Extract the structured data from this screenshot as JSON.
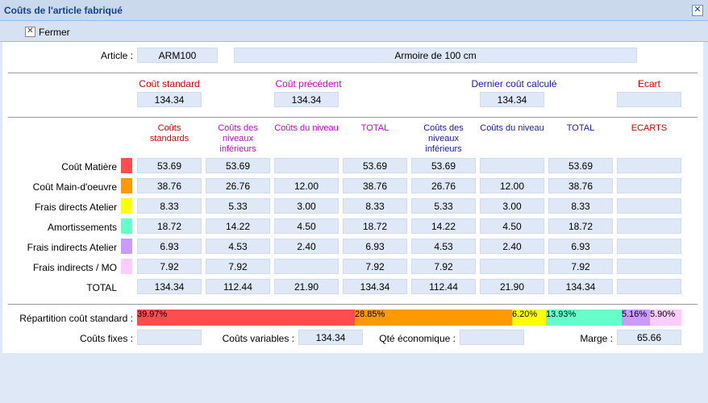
{
  "window": {
    "title": "Coûts de l'article fabriqué"
  },
  "toolbar": {
    "close_label": "Fermer"
  },
  "article": {
    "label": "Article :",
    "code": "ARM100",
    "description": "Armoire de 100 cm"
  },
  "summary": {
    "labels": [
      "Coût standard",
      "Coût précédent",
      "Dernier coût calculé",
      "Ecart"
    ],
    "values": [
      "134.34",
      "134.34",
      "134.34",
      ""
    ]
  },
  "headers": [
    "Coûts standards",
    "Coûts des niveaux inférieurs",
    "Coûts du niveau",
    "TOTAL",
    "Coûts des niveaux inférieurs",
    "Coûts du niveau",
    "TOTAL",
    "ECARTS"
  ],
  "colors": {
    "matiere": "#ff4d4d",
    "mo": "#ff9900",
    "frais_directs": "#ffff00",
    "amort": "#66ffcc",
    "frais_indirects": "#cc99ff",
    "frais_mo": "#ffccff"
  },
  "rows": [
    {
      "label": "Coût Matière",
      "color": "#ff4d4d",
      "values": [
        "53.69",
        "53.69",
        "",
        "53.69",
        "53.69",
        "",
        "53.69",
        ""
      ]
    },
    {
      "label": "Coût Main-d'oeuvre",
      "color": "#ff9900",
      "values": [
        "38.76",
        "26.76",
        "12.00",
        "38.76",
        "26.76",
        "12.00",
        "38.76",
        ""
      ]
    },
    {
      "label": "Frais directs Atelier",
      "color": "#ffff00",
      "values": [
        "8.33",
        "5.33",
        "3.00",
        "8.33",
        "5.33",
        "3.00",
        "8.33",
        ""
      ]
    },
    {
      "label": "Amortissements",
      "color": "#66ffcc",
      "values": [
        "18.72",
        "14.22",
        "4.50",
        "18.72",
        "14.22",
        "4.50",
        "18.72",
        ""
      ]
    },
    {
      "label": "Frais indirects Atelier",
      "color": "#cc99ff",
      "values": [
        "6.93",
        "4.53",
        "2.40",
        "6.93",
        "4.53",
        "2.40",
        "6.93",
        ""
      ]
    },
    {
      "label": "Frais indirects / MO",
      "color": "#ffccff",
      "values": [
        "7.92",
        "7.92",
        "",
        "7.92",
        "7.92",
        "",
        "7.92",
        ""
      ]
    },
    {
      "label": "TOTAL",
      "color": "",
      "values": [
        "134.34",
        "112.44",
        "21.90",
        "134.34",
        "112.44",
        "21.90",
        "134.34",
        ""
      ]
    }
  ],
  "repartition": {
    "label": "Répartition coût standard :",
    "segments": [
      {
        "text": "39.97%",
        "percent": 39.97,
        "color": "#ff4d4d"
      },
      {
        "text": "28.85%",
        "percent": 28.85,
        "color": "#ff9900"
      },
      {
        "text": "6.20%",
        "percent": 6.2,
        "color": "#ffff00"
      },
      {
        "text": "13.93%",
        "percent": 13.93,
        "color": "#66ffcc"
      },
      {
        "text": "5.16%",
        "percent": 5.16,
        "color": "#cc99ff"
      },
      {
        "text": "5.90%",
        "percent": 5.9,
        "color": "#ffccff"
      }
    ]
  },
  "footer": {
    "fixed_label": "Coûts fixes :",
    "fixed_value": "",
    "variable_label": "Coûts variables :",
    "variable_value": "134.34",
    "qty_label": "Qté économique :",
    "qty_value": "",
    "margin_label": "Marge :",
    "margin_value": "65.66"
  }
}
